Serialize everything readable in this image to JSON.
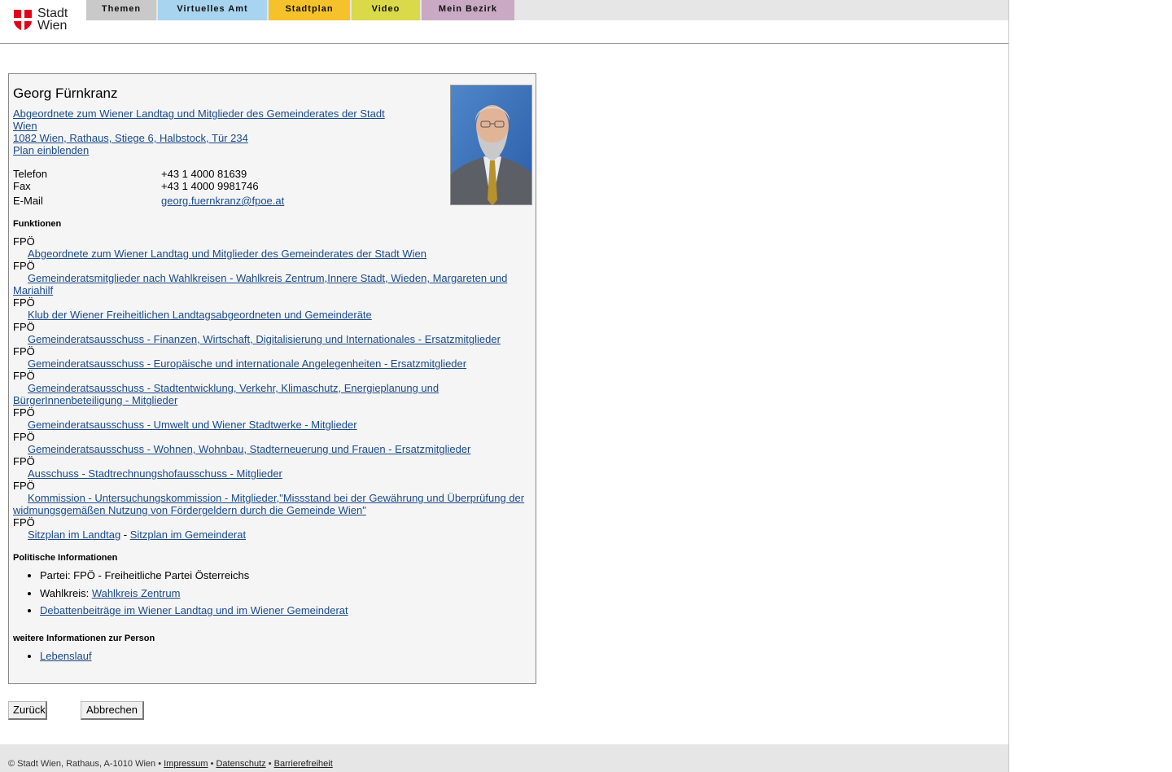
{
  "header": {
    "logo_line1": "Stadt",
    "logo_line2": "Wien",
    "tabs": [
      {
        "label": "Themen"
      },
      {
        "label": "Virtuelles Amt"
      },
      {
        "label": "Stadtplan"
      },
      {
        "label": "Video"
      },
      {
        "label": "Mein Bezirk"
      }
    ]
  },
  "person": {
    "name": "Georg Fürnkranz",
    "role_link": "Abgeordnete zum Wiener Landtag und Mitglieder des Gemeinderates der Stadt Wien",
    "address_link": "1082 Wien, Rathaus, Stiege 6, Halbstock, Tür 234",
    "plan_link": "Plan einblenden",
    "contact": {
      "phone_label": "Telefon",
      "phone": "+43 1 4000 81639",
      "fax_label": "Fax",
      "fax": "+43 1 4000 9981746",
      "email_label": "E-Mail",
      "email": "georg.fuernkranz@fpoe.at"
    }
  },
  "functions": {
    "title": "Funktionen",
    "items": [
      {
        "party": "FPÖ",
        "label": "Abgeordnete zum Wiener Landtag und Mitglieder des Gemeinderates der Stadt Wien"
      },
      {
        "party": "FPÖ",
        "label": "Gemeinderatsmitglieder nach Wahlkreisen - Wahlkreis Zentrum,Innere Stadt, Wieden, Margareten und Mariahilf"
      },
      {
        "party": "FPÖ",
        "label": "Klub der Wiener Freiheitlichen Landtagsabgeordneten und Gemeinderäte"
      },
      {
        "party": "FPÖ",
        "label": "Gemeinderatsausschuss - Finanzen, Wirtschaft, Digitalisierung und Internationales - Ersatzmitglieder"
      },
      {
        "party": "FPÖ",
        "label": "Gemeinderatsausschuss - Europäische und internationale Angelegenheiten - Ersatzmitglieder"
      },
      {
        "party": "FPÖ",
        "label": "Gemeinderatsausschuss - Stadtentwicklung, Verkehr, Klimaschutz, Energieplanung und BürgerInnenbeteiligung - Mitglieder"
      },
      {
        "party": "FPÖ",
        "label": "Gemeinderatsausschuss - Umwelt und Wiener Stadtwerke - Mitglieder"
      },
      {
        "party": "FPÖ",
        "label": "Gemeinderatsausschuss - Wohnen, Wohnbau, Stadterneuerung und Frauen - Ersatzmitglieder"
      },
      {
        "party": "FPÖ",
        "label": "Ausschuss - Stadtrechnungshofausschuss - Mitglieder"
      },
      {
        "party": "FPÖ",
        "label": "Kommission - Untersuchungskommission - Mitglieder,\"Missstand bei der Gewährung und Überprüfung der widmungsgemäßen Nutzung von Fördergeldern durch die Gemeinde Wien\""
      }
    ],
    "last_party": "FPÖ",
    "seat_landtag": "Sitzplan im Landtag",
    "seat_separator": " - ",
    "seat_gemeinderat": "Sitzplan im Gemeinderat"
  },
  "political": {
    "title": "Politische Informationen",
    "party_text": "Partei: FPÖ - Freiheitliche Partei Österreichs",
    "district_label": "Wahlkreis: ",
    "district_link": "Wahlkreis Zentrum",
    "debates_link": "Debattenbeiträge im Wiener Landtag und im Wiener Gemeinderat"
  },
  "more": {
    "title": "weitere Informationen zur Person",
    "cv_link": "Lebenslauf"
  },
  "buttons": {
    "back": "Zurück",
    "cancel": "Abbrechen"
  },
  "footer": {
    "copyright": "© Stadt Wien, Rathaus, A-1010 Wien",
    "bullet": " • ",
    "impressum": "Impressum",
    "datenschutz": "Datenschutz",
    "barrierefreiheit": "Barrierefreiheit"
  },
  "colors": {
    "link": "#1a4a8a",
    "tab_themen": "#c9c9c9",
    "tab_virtuelles_amt": "#a9d4ef",
    "tab_stadtplan": "#f5c22b",
    "tab_video": "#d9d94a",
    "tab_mein_bezirk": "#c9a9c3",
    "logo_red": "#e2001a"
  }
}
